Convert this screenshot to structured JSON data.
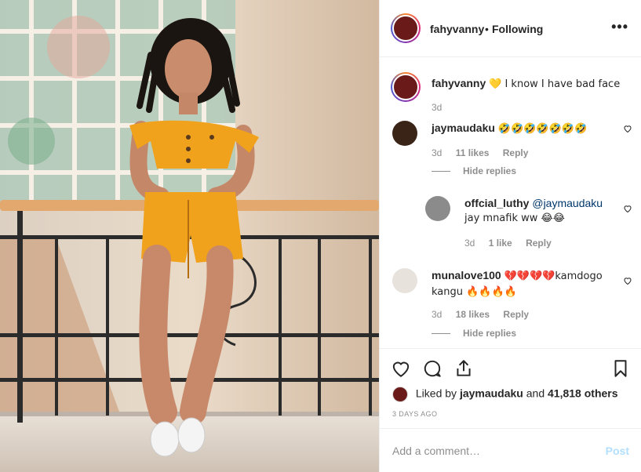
{
  "header": {
    "username": "fahyvanny",
    "separator": "•",
    "follow_status": "Following",
    "more_label": "•••"
  },
  "caption": {
    "username": "fahyvanny",
    "text": "💛 I know I have bad face",
    "time": "3d"
  },
  "comments": [
    {
      "username": "jaymaudaku",
      "text": "🤣🤣🤣🤣🤣🤣🤣",
      "time": "3d",
      "likes": "11 likes",
      "reply": "Reply",
      "hide": "Hide replies"
    },
    {
      "username": "offcial_luthy",
      "mention": "@jaymaudaku",
      "text": "jay mnafik ww 😂😂",
      "time": "3d",
      "likes": "1 like",
      "reply": "Reply"
    },
    {
      "username": "munalove100",
      "text": "💔💔💔💔kamdogo",
      "text2": "kangu 🔥🔥🔥🔥",
      "time": "3d",
      "likes": "18 likes",
      "reply": "Reply",
      "hide": "Hide replies"
    }
  ],
  "likes": {
    "prefix": "Liked by",
    "user": "jaymaudaku",
    "and": "and",
    "others": "41,818 others"
  },
  "timestamp": "3 DAYS AGO",
  "add_comment": {
    "placeholder": "Add a comment…",
    "post_label": "Post"
  },
  "colors": {
    "accent": "#0095f6",
    "post_disabled": "#b2dffc",
    "outfit": "#f0a21c"
  },
  "icons": [
    "heart-icon",
    "comment-icon",
    "share-icon",
    "bookmark-icon",
    "more-icon"
  ]
}
